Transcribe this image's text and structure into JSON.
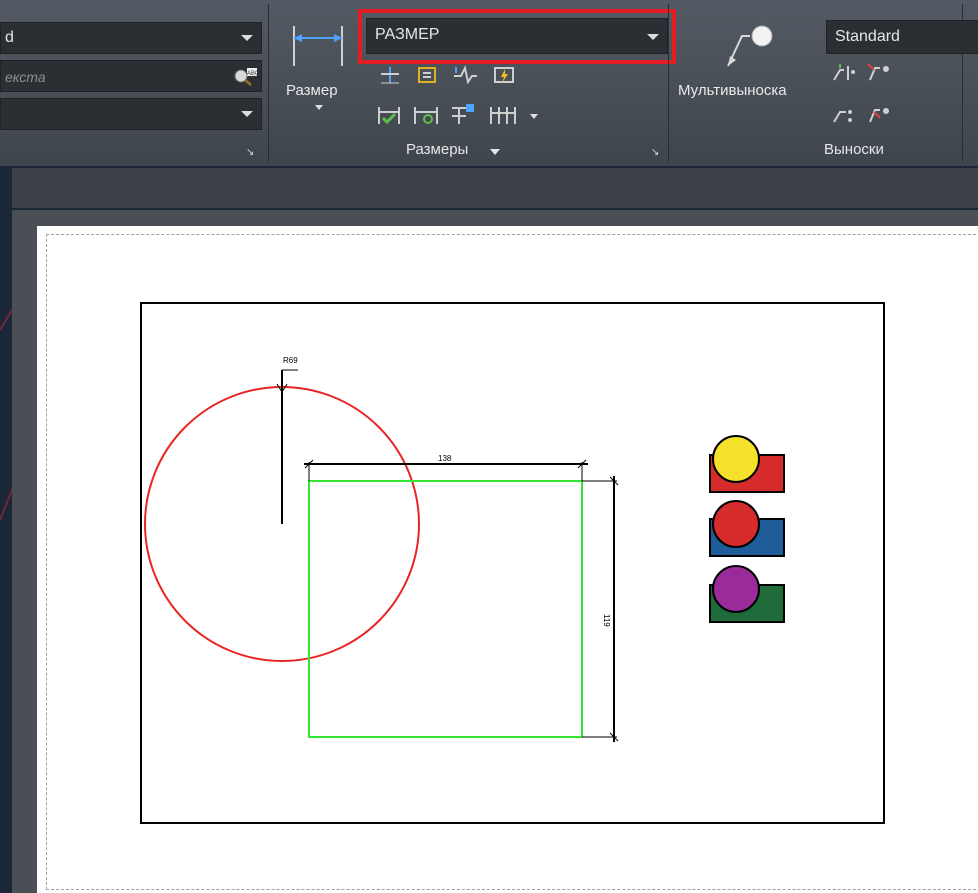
{
  "ribbon": {
    "annotation_panel": {
      "style_combo_value": "d",
      "find_text_placeholder": "екста",
      "layer_combo_value": "",
      "icon": "find-text-abc-icon"
    },
    "dimensions_panel": {
      "dim_button_label": "Размер",
      "dim_style_combo_value": "РАЗМЕР",
      "panel_title": "Размеры",
      "icons": [
        "linear-dimension-icon",
        "quick-dim-icon",
        "dim-text-icon",
        "jog-line-icon",
        "update-dim-icon",
        "baseline-icon",
        "inspect-icon",
        "space-icon",
        "break-icon",
        "continue-icon"
      ]
    },
    "leaders_panel": {
      "multileader_button_label": "Мультивыноска",
      "leader_style_combo_value": "Standard",
      "panel_title": "Выноски",
      "icons": [
        "add-leader-icon",
        "remove-leader-icon",
        "align-leader-icon",
        "collect-leader-icon"
      ]
    }
  },
  "highlight_color": "#e51c24",
  "drawing": {
    "radius_label": "R69",
    "width_label": "138",
    "height_label": "119",
    "circle_color": "#e82525",
    "rect_color": "#33e633",
    "legend": [
      {
        "circle": "#f5e22a",
        "box": "#d62b2b"
      },
      {
        "circle": "#d62b2b",
        "box": "#1e5c9a"
      },
      {
        "circle": "#9b2a9b",
        "box": "#1f6b3a"
      }
    ]
  }
}
